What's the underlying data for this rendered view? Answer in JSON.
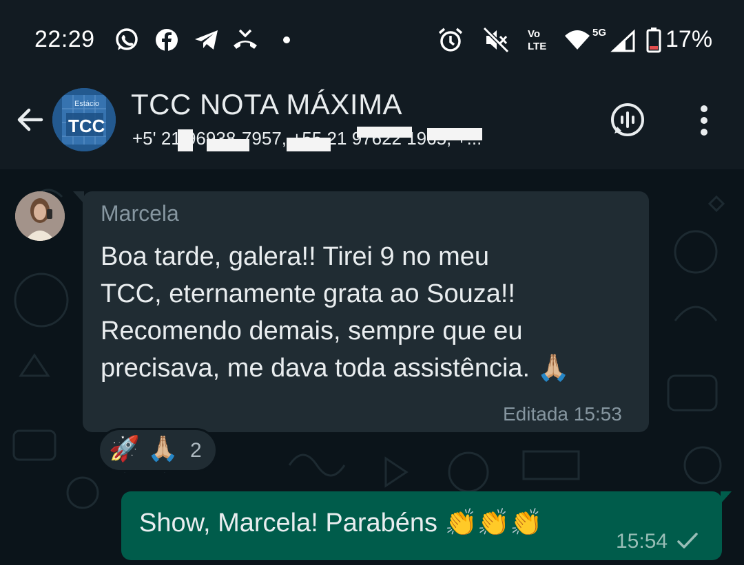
{
  "status_bar": {
    "time": "22:29",
    "battery": "17%",
    "network_label_top": "Vo",
    "network_label_bottom": "LTE",
    "signal_label": "5G",
    "icons": [
      "whatsapp-icon",
      "facebook-icon",
      "telegram-icon",
      "missed-call-icon",
      "dot-icon",
      "alarm-icon",
      "mute-icon",
      "volte-icon",
      "wifi-icon",
      "signal-icon",
      "battery-icon"
    ]
  },
  "header": {
    "title": "TCC NOTA MÁXIMA",
    "subtitle": "+5' 21 96938-7957, +55 21 97622 1965, +...",
    "avatar_text_top": "Estácio",
    "avatar_text_main": "TCC"
  },
  "incoming": {
    "sender": "Marcela",
    "lines": [
      "Boa tarde, galera!! Tirei 9 no meu",
      "TCC, eternamente grata ao Souza!!",
      "Recomendo demais, sempre que eu",
      "precisava, me dava toda assistência. 🙏🏼"
    ],
    "meta": "Editada 15:53",
    "reactions": {
      "emojis": [
        "🚀",
        "🙏🏼"
      ],
      "count": "2"
    }
  },
  "outgoing": {
    "text": "Show, Marcela! Parabéns 👏👏👏",
    "time": "15:54"
  },
  "colors": {
    "background": "#0b141a",
    "bar": "#121b22",
    "incoming_bubble": "#202c33",
    "outgoing_bubble": "#005c4b",
    "secondary_text": "#8696a0"
  }
}
